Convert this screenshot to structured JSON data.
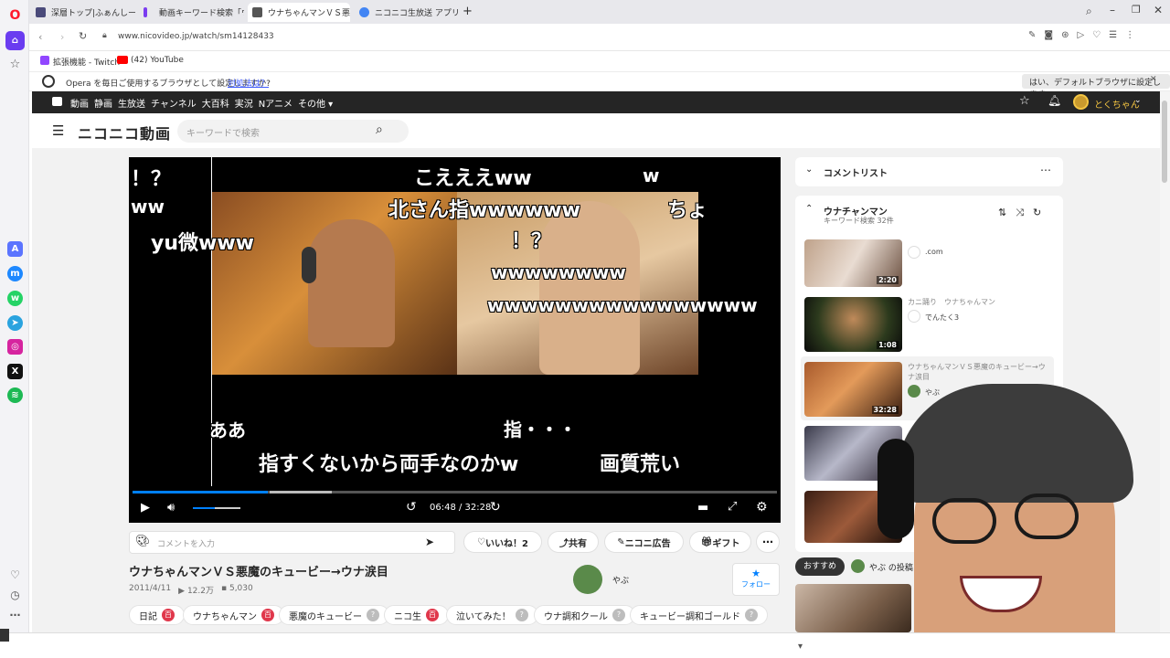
{
  "browser": {
    "tabs": [
      {
        "label": "深層トップ|ふぁんしーあいらん..."
      },
      {
        "label": "動画キーワード検索「ウナチャ..."
      },
      {
        "label": "ウナちゃんマンＶＳ悪魔のキュ..."
      },
      {
        "label": "ニコニコ生放送 アプリ 売上..."
      }
    ],
    "url": "www.nicovideo.jp/watch/sm14128433",
    "bookmarks": [
      {
        "label": "拡張機能 - Twitch"
      },
      {
        "label": "(42) YouTube"
      }
    ],
    "infobar": {
      "message": "Opera を毎日ご使用するブラウザとして設定しますか?",
      "link": "対処法は？",
      "button": "はい、デフォルトブラウザに設定します"
    }
  },
  "nico": {
    "topnav": [
      "動画",
      "静画",
      "生放送",
      "チャンネル",
      "大百科",
      "実況",
      "Nアニメ",
      "その他"
    ],
    "user_name": "とくちゃん",
    "logo": "ニコニコ動画",
    "search_placeholder": "キーワードで検索"
  },
  "player": {
    "comments": [
      {
        "text": "！？"
      },
      {
        "text": "こえええww"
      },
      {
        "text": "w"
      },
      {
        "text": "ww"
      },
      {
        "text": "北さん指wwwwww"
      },
      {
        "text": "ちょ"
      },
      {
        "text": "yu微www"
      },
      {
        "text": "！？"
      },
      {
        "text": "wwwwwwww"
      },
      {
        "text": "wwwwwwwwwwwwwwww"
      },
      {
        "text": "ああ"
      },
      {
        "text": "指・・・"
      },
      {
        "text": "指すくないから両手なのかw"
      },
      {
        "text": "画質荒い"
      }
    ],
    "time": "06:48 / 32:28",
    "progress": 0.21
  },
  "comment_input": {
    "placeholder": "コメントを入力"
  },
  "actions": {
    "like": "いいね！2",
    "share": "共有",
    "ad": "ニコニ広告",
    "gift": "ギフト"
  },
  "video": {
    "title": "ウナちゃんマンＶＳ悪魔のキュービー→ウナ涙目",
    "date": "2011/4/11",
    "views": "12.2万",
    "comments": "5,030",
    "uploader": "やぶ",
    "follow": "フォロー"
  },
  "tags": [
    {
      "label": "日記",
      "badge": "百",
      "badge_color": "#e0374b"
    },
    {
      "label": "ウナちゃんマン",
      "badge": "百",
      "badge_color": "#e0374b"
    },
    {
      "label": "悪魔のキュービー",
      "badge": "?",
      "badge_color": "#bdbdbd"
    },
    {
      "label": "ニコ生",
      "badge": "百",
      "badge_color": "#e0374b"
    },
    {
      "label": "泣いてみた！",
      "badge": "?",
      "badge_color": "#bdbdbd"
    },
    {
      "label": "ウナ調和クール",
      "badge": "?",
      "badge_color": "#bdbdbd"
    },
    {
      "label": "キュービー調和ゴールド",
      "badge": "?",
      "badge_color": "#bdbdbd"
    }
  ],
  "right_panel": {
    "comment_list": "コメントリスト",
    "playlist_title": "ウナチャンマン",
    "playlist_sub": "キーワード検索  32件",
    "items": [
      {
        "duration": "2:20",
        "title": "",
        "owner": ".com"
      },
      {
        "duration": "1:08",
        "title": "カニ踊り　ウナちゃんマン",
        "owner": "でんたく3"
      },
      {
        "duration": "32:28",
        "title": "ウナちゃんマンＶＳ悪魔のキュービー→ウナ涙目",
        "owner": "やぶ"
      },
      {
        "duration": "",
        "title": "",
        "owner": ""
      },
      {
        "duration": "",
        "title": "",
        "owner": ""
      }
    ],
    "tabs": [
      "おすすめ",
      "やぶ の投稿"
    ]
  },
  "colors": {
    "nico_dark": "#252525",
    "accent_blue": "#0080ff",
    "opera_red": "#ff1b2d",
    "badge_red": "#e0374b"
  }
}
